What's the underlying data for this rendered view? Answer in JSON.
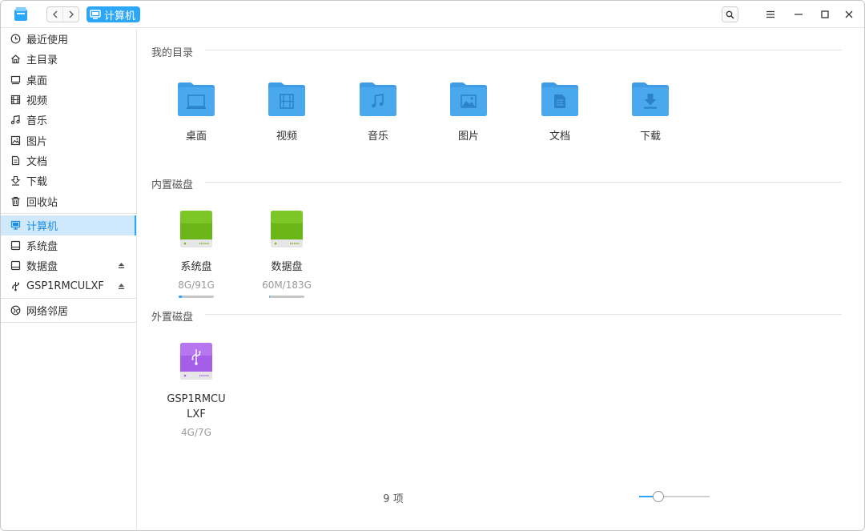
{
  "titlebar": {
    "breadcrumb": "计算机"
  },
  "sidebar": {
    "items": [
      {
        "label": "最近使用",
        "icon": "clock-icon"
      },
      {
        "label": "主目录",
        "icon": "home-icon"
      },
      {
        "label": "桌面",
        "icon": "desktop-icon"
      },
      {
        "label": "视频",
        "icon": "film-icon"
      },
      {
        "label": "音乐",
        "icon": "music-icon"
      },
      {
        "label": "图片",
        "icon": "picture-icon"
      },
      {
        "label": "文档",
        "icon": "document-icon"
      },
      {
        "label": "下载",
        "icon": "download-icon"
      },
      {
        "label": "回收站",
        "icon": "trash-icon"
      }
    ],
    "devices": [
      {
        "label": "计算机",
        "icon": "computer-icon",
        "active": true
      },
      {
        "label": "系统盘",
        "icon": "disk-icon"
      },
      {
        "label": "数据盘",
        "icon": "disk-icon",
        "eject": true
      },
      {
        "label": "GSP1RMCULXF",
        "icon": "usb-icon",
        "eject": true
      }
    ],
    "network": {
      "label": "网络邻居",
      "icon": "network-icon"
    }
  },
  "main": {
    "my_dirs": {
      "title": "我的目录",
      "items": [
        {
          "label": "桌面",
          "icon": "desktop-folder-icon"
        },
        {
          "label": "视频",
          "icon": "video-folder-icon"
        },
        {
          "label": "音乐",
          "icon": "music-folder-icon"
        },
        {
          "label": "图片",
          "icon": "picture-folder-icon"
        },
        {
          "label": "文档",
          "icon": "document-folder-icon"
        },
        {
          "label": "下载",
          "icon": "download-folder-icon"
        }
      ]
    },
    "internal_disks": {
      "title": "内置磁盘",
      "items": [
        {
          "label": "系统盘",
          "usage": "8G/91G",
          "used_fraction": 0.088
        },
        {
          "label": "数据盘",
          "usage": "60M/183G",
          "used_fraction": 0.0003
        }
      ]
    },
    "external_disks": {
      "title": "外置磁盘",
      "items": [
        {
          "label": "GSP1RMCULXF",
          "usage": "4G/7G"
        }
      ]
    }
  },
  "status": {
    "item_count": "9 项",
    "zoom_fraction": 0.27
  },
  "colors": {
    "accent": "#2ca7f8",
    "folder": "#4aa9ee",
    "internal_disk": "#6ab517",
    "external_disk": "#a55ee8"
  }
}
